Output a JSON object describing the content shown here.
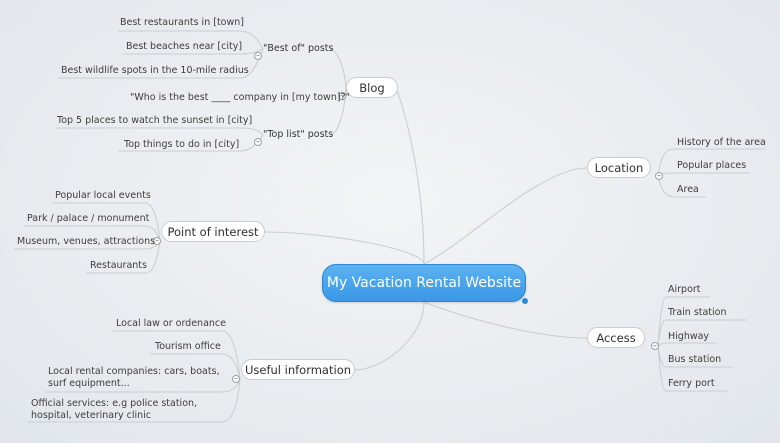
{
  "root": {
    "label": "My Vacation Rental Website"
  },
  "blog": {
    "label": "Blog",
    "best_of": {
      "label": "\"Best of\" posts",
      "items": [
        "Best restaurants in [town]",
        "Best beaches near [city]",
        "Best wildlife spots in the 10-mile radius"
      ]
    },
    "question_post": "\"Who is the best ____ company in [my town]?\"",
    "top_list": {
      "label": "\"Top list\" posts",
      "items": [
        "Top 5 places to watch the sunset in [city]",
        "Top things to do in [city]"
      ]
    }
  },
  "poi": {
    "label": "Point of interest",
    "items": [
      "Popular local events",
      "Park / palace / monument",
      "Museum, venues, attractions",
      "Restaurants"
    ]
  },
  "useful": {
    "label": "Useful information",
    "items": [
      "Local law or ordenance",
      "Tourism office",
      "Local rental companies: cars, boats, surf equipment...",
      "Official services: e.g police station, hospital, veterinary clinic"
    ]
  },
  "location": {
    "label": "Location",
    "items": [
      "History of the area",
      "Popular places",
      "Area"
    ]
  },
  "access": {
    "label": "Access",
    "items": [
      "Airport",
      "Train station",
      "Highway",
      "Bus station",
      "Ferry port"
    ]
  },
  "colors": {
    "root_fill": "#45a4ec",
    "link": "#c9ced3",
    "background": "#e9edf0"
  },
  "icons": {
    "collapse": "minus-icon"
  }
}
